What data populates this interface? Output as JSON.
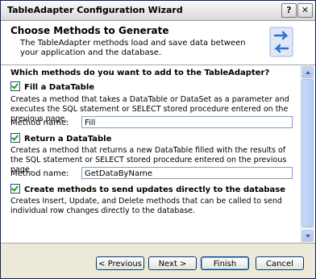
{
  "window": {
    "title": "TableAdapter Configuration Wizard",
    "help_glyph": "?",
    "close_glyph": "✕"
  },
  "header": {
    "title": "Choose Methods to Generate",
    "description": "The TableAdapter methods load and save data between your application and the database.",
    "icon": "wizard-sync-icon"
  },
  "content": {
    "question": "Which methods do you want to add to the TableAdapter?",
    "options": [
      {
        "label": "Fill a DataTable",
        "checked": true,
        "description": "Creates a method that takes a DataTable or DataSet as a parameter and executes the SQL statement or SELECT stored procedure entered on the previous page.",
        "method_label": "Method name:",
        "method_value": "Fill"
      },
      {
        "label": "Return a DataTable",
        "checked": true,
        "description": "Creates a method that returns a new DataTable filled with the results of the SQL statement or SELECT stored procedure entered on the previous page.",
        "method_label": "Method name:",
        "method_value": "GetDataByName"
      },
      {
        "label": "Create methods to send updates directly to the database",
        "checked": true,
        "description": "Creates Insert, Update, and Delete methods that can be called to send individual row changes directly to the database."
      }
    ]
  },
  "footer": {
    "previous": "< Previous",
    "next": "Next >",
    "finish": "Finish",
    "cancel": "Cancel"
  },
  "colors": {
    "title_bar": "#d8d8d8",
    "dialog_bg": "#ece9d8",
    "check_mark": "#21a121",
    "button_border": "#003c74"
  }
}
